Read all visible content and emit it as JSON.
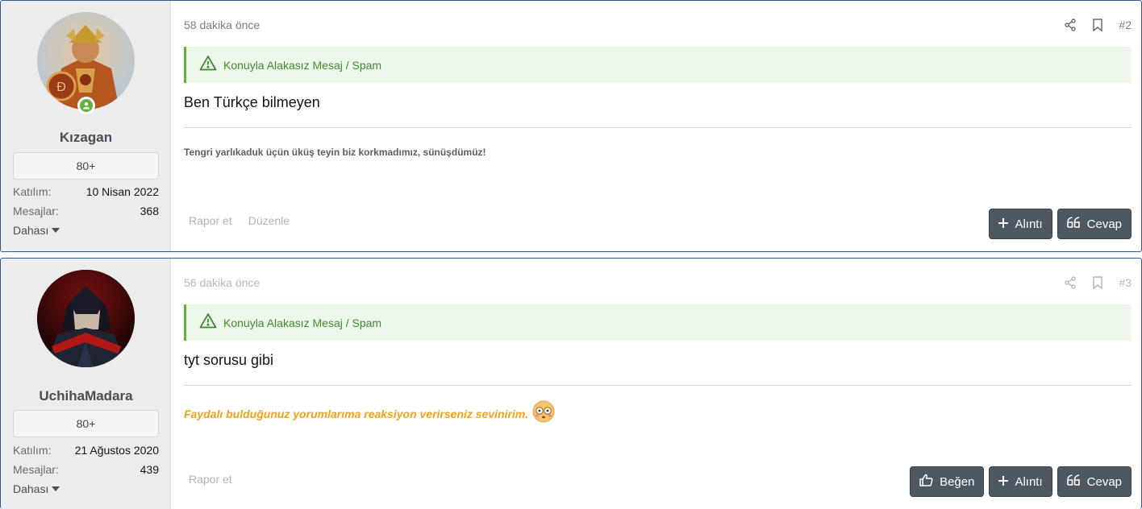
{
  "posts": [
    {
      "username": "Kızagan",
      "badge": "80+",
      "stats": [
        {
          "label": "Katılım:",
          "value": "10 Nisan 2022"
        },
        {
          "label": "Mesajlar:",
          "value": "368"
        }
      ],
      "more_label": "Dahası",
      "time": "58 dakika önce",
      "post_number": "#2",
      "notice": "Konuyla Alakasız Mesaj / Spam",
      "content": "Ben Türkçe bilmeyen",
      "signature": "Tengri yarlıkaduk üçün üküş teyin biz korkmadımız, sünüşdümüz!",
      "footer_links": [
        "Rapor et",
        "Düzenle"
      ],
      "buttons": [
        {
          "label": "Alıntı",
          "icon": "plus-icon"
        },
        {
          "label": "Cevap",
          "icon": "quote-icon"
        }
      ],
      "online": true
    },
    {
      "username": "UchihaMadara",
      "badge": "80+",
      "stats": [
        {
          "label": "Katılım:",
          "value": "21 Ağustos 2020"
        },
        {
          "label": "Mesajlar:",
          "value": "439"
        }
      ],
      "more_label": "Dahası",
      "time": "56 dakika önce",
      "post_number": "#3",
      "notice": "Konuyla Alakasız Mesaj / Spam",
      "content": "tyt sorusu gibi",
      "signature": "Faydalı bulduğunuz yorumlarıma reaksiyon verirseniz sevinirim.",
      "signature_color": "#f0a21f",
      "footer_links": [
        "Rapor et"
      ],
      "buttons": [
        {
          "label": "Beğen",
          "icon": "thumbs-up-icon"
        },
        {
          "label": "Alıntı",
          "icon": "plus-icon"
        },
        {
          "label": "Cevap",
          "icon": "quote-icon"
        }
      ]
    }
  ],
  "colors": {
    "accent_border": "#2e5a8a",
    "notice_green": "#63b03f",
    "button_bg": "#4d5861"
  }
}
